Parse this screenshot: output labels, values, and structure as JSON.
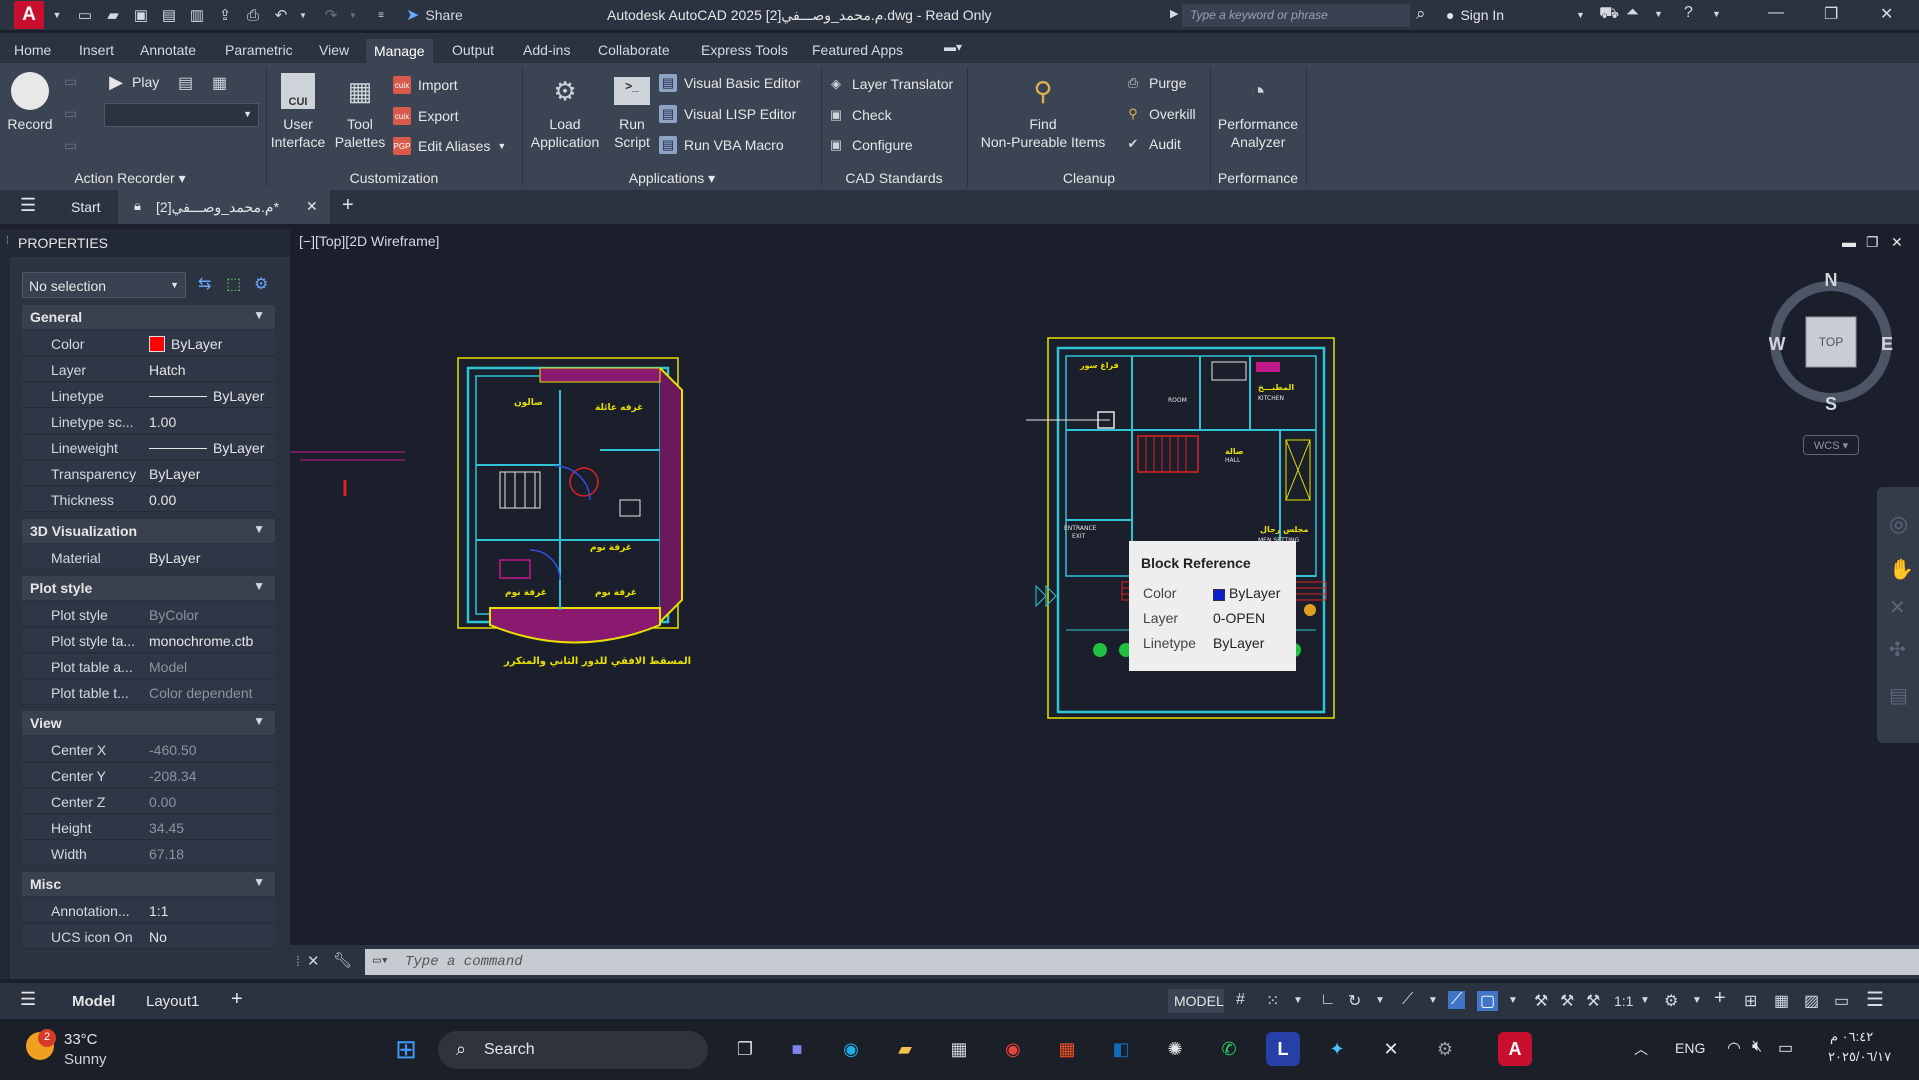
{
  "titlebar": {
    "logo": "A",
    "share_label": "Share",
    "title": "Autodesk AutoCAD 2025   م.محمد_وصـــفي[2].dwg - Read Only",
    "search_placeholder": "Type a keyword or phrase",
    "signin_label": "Sign In"
  },
  "ribbon_tabs": [
    "Home",
    "Insert",
    "Annotate",
    "Parametric",
    "View",
    "Manage",
    "Output",
    "Add-ins",
    "Collaborate",
    "Express Tools",
    "Featured Apps"
  ],
  "active_tab": "Manage",
  "ribbon": {
    "action_recorder": {
      "record": "Record",
      "play": "Play",
      "title": "Action Recorder"
    },
    "customization": {
      "user_interface": "User Interface",
      "user_line1": "User",
      "user_line2": "Interface",
      "tool_line1": "Tool",
      "tool_line2": "Palettes",
      "import": "Import",
      "export": "Export",
      "edit_aliases": "Edit Aliases",
      "title": "Customization"
    },
    "applications": {
      "load_line1": "Load",
      "load_line2": "Application",
      "run_line1": "Run",
      "run_line2": "Script",
      "vbe": "Visual Basic Editor",
      "vlisp": "Visual LISP Editor",
      "vba_macro": "Run VBA Macro",
      "title": "Applications"
    },
    "cad_standards": {
      "layer_translator": "Layer Translator",
      "check": "Check",
      "configure": "Configure",
      "title": "CAD Standards"
    },
    "cleanup": {
      "find_line1": "Find",
      "find_line2": "Non-Pureable Items",
      "purge": "Purge",
      "overkill": "Overkill",
      "audit": "Audit",
      "title": "Cleanup"
    },
    "performance": {
      "perf_line1": "Performance",
      "perf_line2": "Analyzer",
      "title": "Performance"
    }
  },
  "file_tabs": {
    "start": "Start",
    "doc": "م.محمد_وصـــفي[2]*"
  },
  "properties": {
    "title": "PROPERTIES",
    "selection": "No selection",
    "general": {
      "title": "General",
      "rows": [
        {
          "k": "Color",
          "v": "ByLayer"
        },
        {
          "k": "Layer",
          "v": "Hatch"
        },
        {
          "k": "Linetype",
          "v": "ByLayer"
        },
        {
          "k": "Linetype sc...",
          "v": "1.00"
        },
        {
          "k": "Lineweight",
          "v": "ByLayer"
        },
        {
          "k": "Transparency",
          "v": "ByLayer"
        },
        {
          "k": "Thickness",
          "v": "0.00"
        }
      ]
    },
    "viz": {
      "title": "3D Visualization",
      "rows": [
        {
          "k": "Material",
          "v": "ByLayer"
        }
      ]
    },
    "plot": {
      "title": "Plot style",
      "rows": [
        {
          "k": "Plot style",
          "v": "ByColor"
        },
        {
          "k": "Plot style ta...",
          "v": "monochrome.ctb"
        },
        {
          "k": "Plot table a...",
          "v": "Model"
        },
        {
          "k": "Plot table t...",
          "v": "Color dependent"
        }
      ]
    },
    "view": {
      "title": "View",
      "rows": [
        {
          "k": "Center X",
          "v": "-460.50"
        },
        {
          "k": "Center Y",
          "v": "-208.34"
        },
        {
          "k": "Center Z",
          "v": "0.00"
        },
        {
          "k": "Height",
          "v": "34.45"
        },
        {
          "k": "Width",
          "v": "67.18"
        }
      ]
    },
    "misc": {
      "title": "Misc",
      "rows": [
        {
          "k": "Annotation...",
          "v": "1:1"
        },
        {
          "k": "UCS icon On",
          "v": "No"
        }
      ]
    }
  },
  "viewport": {
    "label": "[−][Top][2D Wireframe]",
    "viewcube": {
      "n": "N",
      "s": "S",
      "e": "E",
      "w": "W",
      "top": "TOP"
    },
    "wcs": "WCS"
  },
  "tooltip": {
    "title": "Block Reference",
    "rows": [
      {
        "k": "Color",
        "v": "ByLayer"
      },
      {
        "k": "Layer",
        "v": "0-OPEN"
      },
      {
        "k": "Linetype",
        "v": "ByLayer"
      }
    ]
  },
  "drawing_texts": {
    "plan_caption": "المسقط الافقي للدور الثاني والمتكرر",
    "salon": "صالون",
    "living": "غرفه عائلة",
    "bed1": "غرفة نوم",
    "bed2": "غرفة نوم",
    "bed3": "غرفة نوم",
    "garden_label": "فراغ سور",
    "room": "ROOM",
    "kitchen": "KITCHEN",
    "kitchen_ar": "المطبـــخ",
    "hall": "HALL",
    "hall_ar": "صالة",
    "entrance": "ENTRANCE",
    "exit": "EXIT",
    "men_setting": "MEN SETTING",
    "men_setting_ar": "مجلس رجال"
  },
  "cmdline": {
    "placeholder": "Type a command"
  },
  "status": {
    "model_tab": "Model",
    "layout_tab": "Layout1",
    "model": "MODEL",
    "scale": "1:1"
  },
  "taskbar": {
    "weather_temp": "33°C",
    "weather_desc": "Sunny",
    "badge": "2",
    "search": "Search",
    "lang": "ENG",
    "time": "٠٦:٤٢ م",
    "date": "٢٠٢٥/٠٦/١٧"
  },
  "colors": {
    "accent": "#3f74c6",
    "autocad_red": "#c8102e",
    "canvas": "#1a1f2b",
    "plan_cyan": "#2ec4d6",
    "plan_magenta": "#c2188c",
    "plan_yellow": "#e8e000"
  }
}
